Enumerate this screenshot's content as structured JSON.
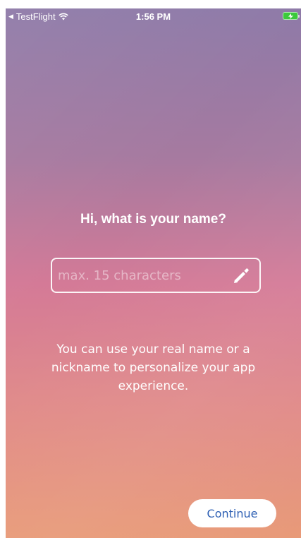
{
  "status_bar": {
    "carrier": "TestFlight",
    "time": "1:56 PM"
  },
  "main": {
    "question": "Hi, what is your name?",
    "name_input": {
      "value": "",
      "placeholder": "max. 15 characters"
    },
    "helper_text": "You can use your real name or a nickname to personalize your app experience.",
    "continue_label": "Continue"
  },
  "icons": {
    "back": "back-arrow-icon",
    "wifi": "wifi-icon",
    "battery": "battery-charging-icon",
    "edit": "pencil-icon"
  },
  "colors": {
    "accent": "#2d5fb3",
    "battery": "#3cc93c",
    "gradient_top": "#8e7aa8",
    "gradient_bottom": "#e89a78"
  }
}
